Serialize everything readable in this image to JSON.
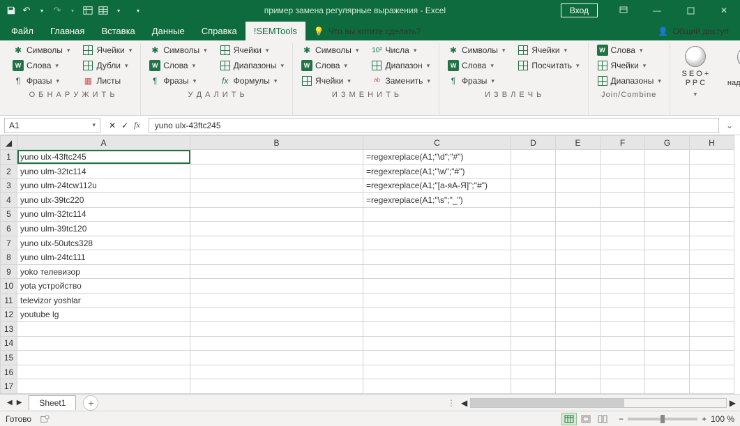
{
  "title": "пример замена регулярные выражения - Excel",
  "login": "Вход",
  "menus": [
    "Файл",
    "Главная",
    "Вставка",
    "Данные",
    "Справка",
    "!SEMTools"
  ],
  "active_menu": 5,
  "tellme": "Что вы хотите сделать?",
  "share": "Общий доступ",
  "groups": {
    "g1": {
      "title": "О Б Н А Р У Ж И Т Ь",
      "c1": [
        "Символы",
        "Слова",
        "Фразы"
      ],
      "c2": [
        "Ячейки",
        "Дубли",
        "Листы"
      ]
    },
    "g2": {
      "title": "У Д А Л И Т Ь",
      "c1": [
        "Символы",
        "Слова",
        "Фразы"
      ],
      "c2": [
        "Ячейки",
        "Диапазоны",
        "Формулы"
      ]
    },
    "g3": {
      "title": "И З М Е Н И Т Ь",
      "c1": [
        "Символы",
        "Слова",
        "Ячейки"
      ],
      "c2": [
        "Числа",
        "Диапазон",
        "Заменить"
      ]
    },
    "g4": {
      "title": "И З В Л Е Ч Ь",
      "c1": [
        "Символы",
        "Слова",
        "Фразы"
      ],
      "c2": [
        "Ячейки",
        "Посчитать"
      ]
    },
    "g5": {
      "title": "Join/Combine",
      "c1": [
        "Слова",
        "Ячейки",
        "Диапазоны"
      ]
    },
    "big1": "S E O +\nP P C",
    "big2": "О надстройке",
    "num_prefix": "10²"
  },
  "namebox": "A1",
  "formula": "yuno ulx-43ftc245",
  "columns": [
    "A",
    "B",
    "C",
    "D",
    "E",
    "F",
    "G",
    "H"
  ],
  "rows": [
    1,
    2,
    3,
    4,
    5,
    6,
    7,
    8,
    9,
    10,
    11,
    12,
    13,
    14,
    15,
    16,
    17
  ],
  "cells": {
    "A1": "yuno ulx-43ftc245",
    "A2": "yuno ulm-32tc114",
    "A3": "yuno ulm-24tcw112u",
    "A4": "yuno ulx-39tc220",
    "A5": "yuno ulm-32tc114",
    "A6": "yuno ulm-39tc120",
    "A7": "yuno ulx-50utcs328",
    "A8": "yuno ulm-24tc111",
    "A9": "yoko телевизор",
    "A10": "yota устройство",
    "A11": "televizor yoshlar",
    "A12": "youtube lg",
    "C1": "=regexreplace(A1;\"\\d\";\"#\")",
    "C2": "=regexreplace(A1;\"\\w\";\"#\")",
    "C3": "=regexreplace(A1;\"[а-яА-Я]\";\"#\")",
    "C4": "=regexreplace(A1;\"\\s\";\"_\")"
  },
  "sheet_tab": "Sheet1",
  "status": "Готово",
  "zoom": "100 %"
}
